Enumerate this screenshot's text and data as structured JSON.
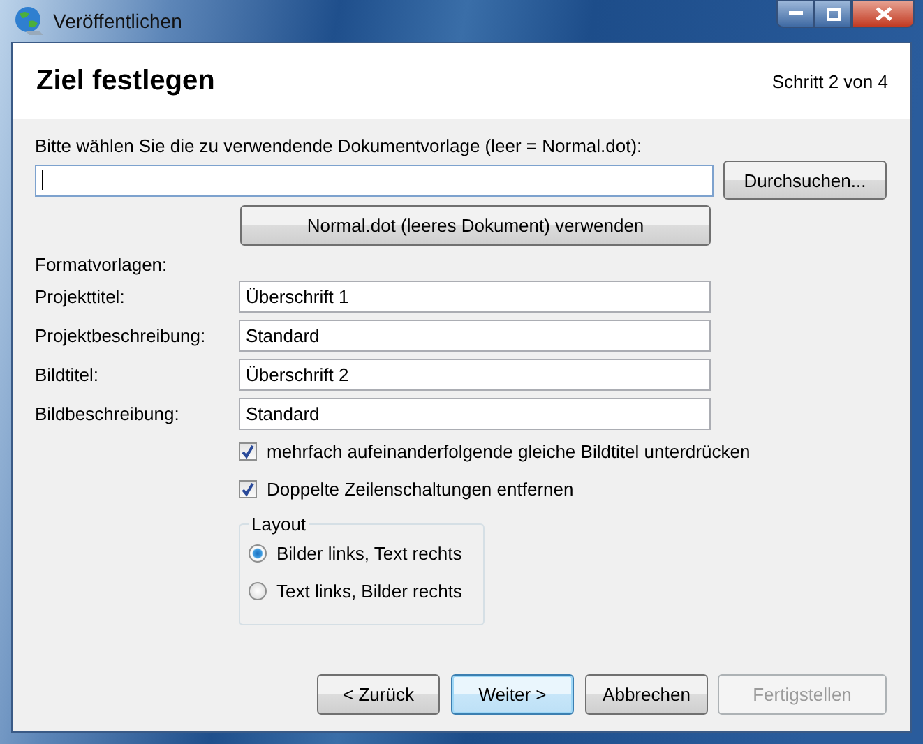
{
  "window": {
    "title": "Veröffentlichen"
  },
  "header": {
    "title": "Ziel festlegen",
    "step": "Schritt 2 von 4"
  },
  "template": {
    "prompt": "Bitte wählen Sie die zu verwendende Dokumentvorlage (leer = Normal.dot):",
    "browse_button": "Durchsuchen...",
    "default_button": "Normal.dot (leeres Dokument) verwenden"
  },
  "styles": {
    "label": "Formatvorlagen:",
    "rows": [
      {
        "label": "Projekttitel:",
        "value": "Überschrift 1"
      },
      {
        "label": "Projektbeschreibung:",
        "value": "Standard"
      },
      {
        "label": "Bildtitel:",
        "value": "Überschrift 2"
      },
      {
        "label": "Bildbeschreibung:",
        "value": "Standard"
      }
    ]
  },
  "options": [
    {
      "label": "mehrfach aufeinanderfolgende gleiche Bildtitel unterdrücken",
      "checked": true
    },
    {
      "label": "Doppelte Zeilenschaltungen entfernen",
      "checked": true
    }
  ],
  "layout": {
    "title": "Layout",
    "options": [
      {
        "label": "Bilder links, Text rechts",
        "selected": true
      },
      {
        "label": "Text links, Bilder rechts",
        "selected": false
      }
    ]
  },
  "buttons": [
    {
      "label": "< Zurück",
      "default": false,
      "disabled": false
    },
    {
      "label": "Weiter >",
      "default": true,
      "disabled": false
    },
    {
      "label": "Abbrechen",
      "default": false,
      "disabled": false
    },
    {
      "label": "Fertigstellen",
      "default": false,
      "disabled": true
    }
  ]
}
